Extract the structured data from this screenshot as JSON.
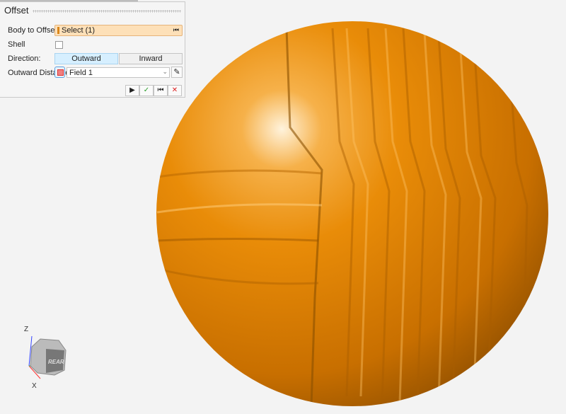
{
  "panel": {
    "title": "Offset",
    "body_label": "Body to Offset:",
    "body_value": "Select (1)",
    "shell_label": "Shell",
    "shell_checked": false,
    "direction_label": "Direction:",
    "outward": "Outward",
    "inward": "Inward",
    "direction_selected": "Outward",
    "distance_label": "Outward Distance:",
    "distance_value": "Field 1",
    "actions": {
      "play": "▶",
      "ok": "✓",
      "skip": "⏮",
      "cancel": "✕"
    }
  },
  "view_cube": {
    "face": "REAR",
    "axis_z": "Z",
    "axis_x": "X"
  },
  "colors": {
    "model": "#e68a00",
    "selection": "#fde0b8",
    "selected_button": "#d6efff"
  }
}
